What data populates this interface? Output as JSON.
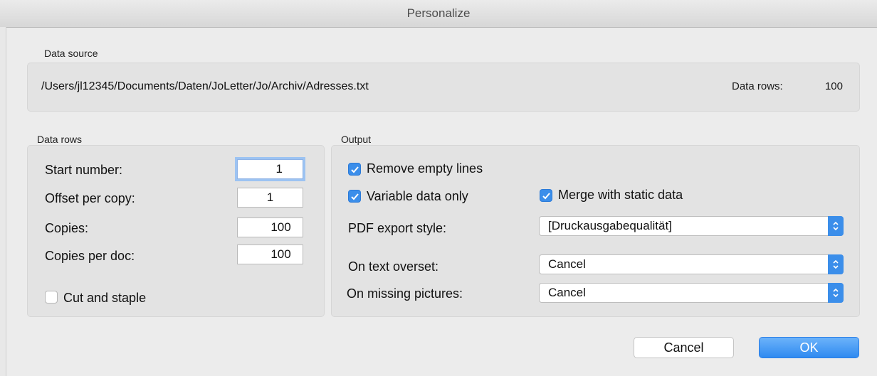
{
  "window": {
    "title": "Personalize"
  },
  "data_source": {
    "group_label": "Data source",
    "path": "/Users/jl12345/Documents/Daten/JoLetter/Jo/Archiv/Adresses.txt",
    "rows_label": "Data rows:",
    "rows_value": "100"
  },
  "data_rows": {
    "group_label": "Data rows",
    "start_number": {
      "label": "Start number:",
      "value": "1"
    },
    "offset_per_copy": {
      "label": "Offset per copy:",
      "value": "1"
    },
    "copies": {
      "label": "Copies:",
      "value": "100"
    },
    "copies_per_doc": {
      "label": "Copies per doc:",
      "value": "100"
    },
    "cut_and_staple": {
      "label": "Cut and staple",
      "checked": false
    }
  },
  "output": {
    "group_label": "Output",
    "remove_empty_lines": {
      "label": "Remove empty lines",
      "checked": true
    },
    "variable_data_only": {
      "label": "Variable data only",
      "checked": true
    },
    "merge_with_static_data": {
      "label": "Merge with static data",
      "checked": true
    },
    "pdf_export_style": {
      "label": "PDF export style:",
      "value": "[Druckausgabequalität]"
    },
    "on_text_overset": {
      "label": "On text overset:",
      "value": "Cancel"
    },
    "on_missing_pictures": {
      "label": "On missing pictures:",
      "value": "Cancel"
    }
  },
  "buttons": {
    "cancel": "Cancel",
    "ok": "OK"
  },
  "colors": {
    "accent": "#3b8eea",
    "panel": "#e3e3e3",
    "window": "#ececec"
  }
}
